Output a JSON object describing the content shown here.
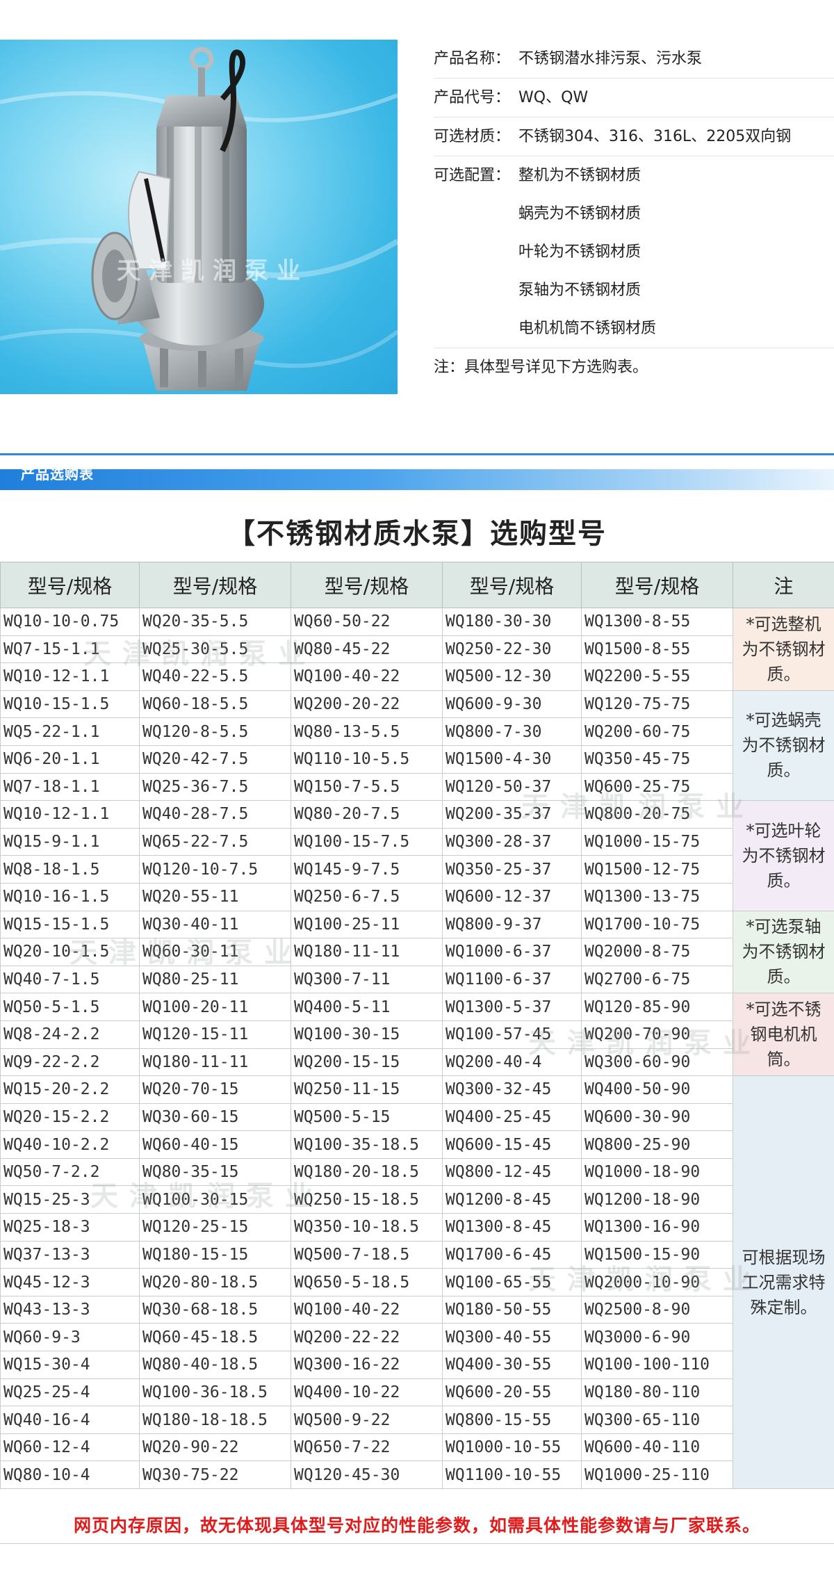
{
  "product": {
    "image_alt": "不锈钢潜水排污泵",
    "watermark": "天津凯润泵业",
    "rows": [
      {
        "label": "产品名称：",
        "value": "不锈钢潜水排污泵、污水泵"
      },
      {
        "label": "产品代号：",
        "value": "WQ、QW"
      },
      {
        "label": "可选材质：",
        "value": "不锈钢304、316、316L、2205双向钢"
      },
      {
        "label": "可选配置：",
        "value": "整机为不锈钢材质"
      },
      {
        "label": "",
        "value": "蜗壳为不锈钢材质"
      },
      {
        "label": "",
        "value": "叶轮为不锈钢材质"
      },
      {
        "label": "",
        "value": "泵轴为不锈钢材质"
      },
      {
        "label": "",
        "value": "电机机筒不锈钢材质"
      },
      {
        "label": "注：",
        "value": "具体型号详见下方选购表。"
      }
    ]
  },
  "section_title": "产品选购表",
  "table_heading": "【不锈钢材质水泵】选购型号",
  "table": {
    "headers": [
      "型号/规格",
      "型号/规格",
      "型号/规格",
      "型号/规格",
      "型号/规格",
      "注"
    ],
    "notes": [
      {
        "text": "*可选整机为不锈钢材质。",
        "color": "#fbece3"
      },
      {
        "text": "*可选蜗壳为不锈钢材质。",
        "color": "#e7f1f5"
      },
      {
        "text": "*可选叶轮为不锈钢材质。",
        "color": "#f3ebf5"
      },
      {
        "text": "*可选泵轴为不锈钢材质。",
        "color": "#eaf3e9"
      },
      {
        "text": "*可选不锈钢电机机筒。",
        "color": "#f7e5e5"
      },
      {
        "text": "可根据现场工况需求特殊定制。",
        "color": "#e5eef5"
      }
    ],
    "rows": [
      [
        "WQ10-10-0.75",
        "WQ20-35-5.5",
        "WQ60-50-22",
        "WQ180-30-30",
        "WQ1300-8-55"
      ],
      [
        "WQ7-15-1.1",
        "WQ25-30-5.5",
        "WQ80-45-22",
        "WQ250-22-30",
        "WQ1500-8-55"
      ],
      [
        "WQ10-12-1.1",
        "WQ40-22-5.5",
        "WQ100-40-22",
        "WQ500-12-30",
        "WQ2200-5-55"
      ],
      [
        "WQ10-15-1.5",
        "WQ60-18-5.5",
        "WQ200-20-22",
        "WQ600-9-30",
        "WQ120-75-75"
      ],
      [
        "WQ5-22-1.1",
        "WQ120-8-5.5",
        "WQ80-13-5.5",
        "WQ800-7-30",
        "WQ200-60-75"
      ],
      [
        "WQ6-20-1.1",
        "WQ20-42-7.5",
        "WQ110-10-5.5",
        "WQ1500-4-30",
        "WQ350-45-75"
      ],
      [
        "WQ7-18-1.1",
        "WQ25-36-7.5",
        "WQ150-7-5.5",
        "WQ120-50-37",
        "WQ600-25-75"
      ],
      [
        "WQ10-12-1.1",
        "WQ40-28-7.5",
        "WQ80-20-7.5",
        "WQ200-35-37",
        "WQ800-20-75"
      ],
      [
        "WQ15-9-1.1",
        "WQ65-22-7.5",
        "WQ100-15-7.5",
        "WQ300-28-37",
        "WQ1000-15-75"
      ],
      [
        "WQ8-18-1.5",
        "WQ120-10-7.5",
        "WQ145-9-7.5",
        "WQ350-25-37",
        "WQ1500-12-75"
      ],
      [
        "WQ10-16-1.5",
        "WQ20-55-11",
        "WQ250-6-7.5",
        "WQ600-12-37",
        "WQ1300-13-75"
      ],
      [
        "WQ15-15-1.5",
        "WQ30-40-11",
        "WQ100-25-11",
        "WQ800-9-37",
        "WQ1700-10-75"
      ],
      [
        "WQ20-10-1.5",
        "WQ60-30-11",
        "WQ180-11-11",
        "WQ1000-6-37",
        "WQ2000-8-75"
      ],
      [
        "WQ40-7-1.5",
        "WQ80-25-11",
        "WQ300-7-11",
        "WQ1100-6-37",
        "WQ2700-6-75"
      ],
      [
        "WQ50-5-1.5",
        "WQ100-20-11",
        "WQ400-5-11",
        "WQ1300-5-37",
        "WQ120-85-90"
      ],
      [
        "WQ8-24-2.2",
        "WQ120-15-11",
        "WQ100-30-15",
        "WQ100-57-45",
        "WQ200-70-90"
      ],
      [
        "WQ9-22-2.2",
        "WQ180-11-11",
        "WQ200-15-15",
        "WQ200-40-4",
        "WQ300-60-90"
      ],
      [
        "WQ15-20-2.2",
        "WQ20-70-15",
        "WQ250-11-15",
        "WQ300-32-45",
        "WQ400-50-90"
      ],
      [
        "WQ20-15-2.2",
        "WQ30-60-15",
        "WQ500-5-15",
        "WQ400-25-45",
        "WQ600-30-90"
      ],
      [
        "WQ40-10-2.2",
        "WQ60-40-15",
        "WQ100-35-18.5",
        "WQ600-15-45",
        "WQ800-25-90"
      ],
      [
        "WQ50-7-2.2",
        "WQ80-35-15",
        "WQ180-20-18.5",
        "WQ800-12-45",
        "WQ1000-18-90"
      ],
      [
        "WQ15-25-3",
        "WQ100-30-15",
        "WQ250-15-18.5",
        "WQ1200-8-45",
        "WQ1200-18-90"
      ],
      [
        "WQ25-18-3",
        "WQ120-25-15",
        "WQ350-10-18.5",
        "WQ1300-8-45",
        "WQ1300-16-90"
      ],
      [
        "WQ37-13-3",
        "WQ180-15-15",
        "WQ500-7-18.5",
        "WQ1700-6-45",
        "WQ1500-15-90"
      ],
      [
        "WQ45-12-3",
        "WQ20-80-18.5",
        "WQ650-5-18.5",
        "WQ100-65-55",
        "WQ2000-10-90"
      ],
      [
        "WQ43-13-3",
        "WQ30-68-18.5",
        "WQ100-40-22",
        "WQ180-50-55",
        "WQ2500-8-90"
      ],
      [
        "WQ60-9-3",
        "WQ60-45-18.5",
        "WQ200-22-22",
        "WQ300-40-55",
        "WQ3000-6-90"
      ],
      [
        "WQ15-30-4",
        "WQ80-40-18.5",
        "WQ300-16-22",
        "WQ400-30-55",
        "WQ100-100-110"
      ],
      [
        "WQ25-25-4",
        "WQ100-36-18.5",
        "WQ400-10-22",
        "WQ600-20-55",
        "WQ180-80-110"
      ],
      [
        "WQ40-16-4",
        "WQ180-18-18.5",
        "WQ500-9-22",
        "WQ800-15-55",
        "WQ300-65-110"
      ],
      [
        "WQ60-12-4",
        "WQ20-90-22",
        "WQ650-7-22",
        "WQ1000-10-55",
        "WQ600-40-110"
      ],
      [
        "WQ80-10-4",
        "WQ30-75-22",
        "WQ120-45-30",
        "WQ1100-10-55",
        "WQ1000-25-110"
      ]
    ]
  },
  "footer_note": "网页内存原因，故无体现具体型号对应的性能参数，如需具体性能参数请与厂家联系。"
}
